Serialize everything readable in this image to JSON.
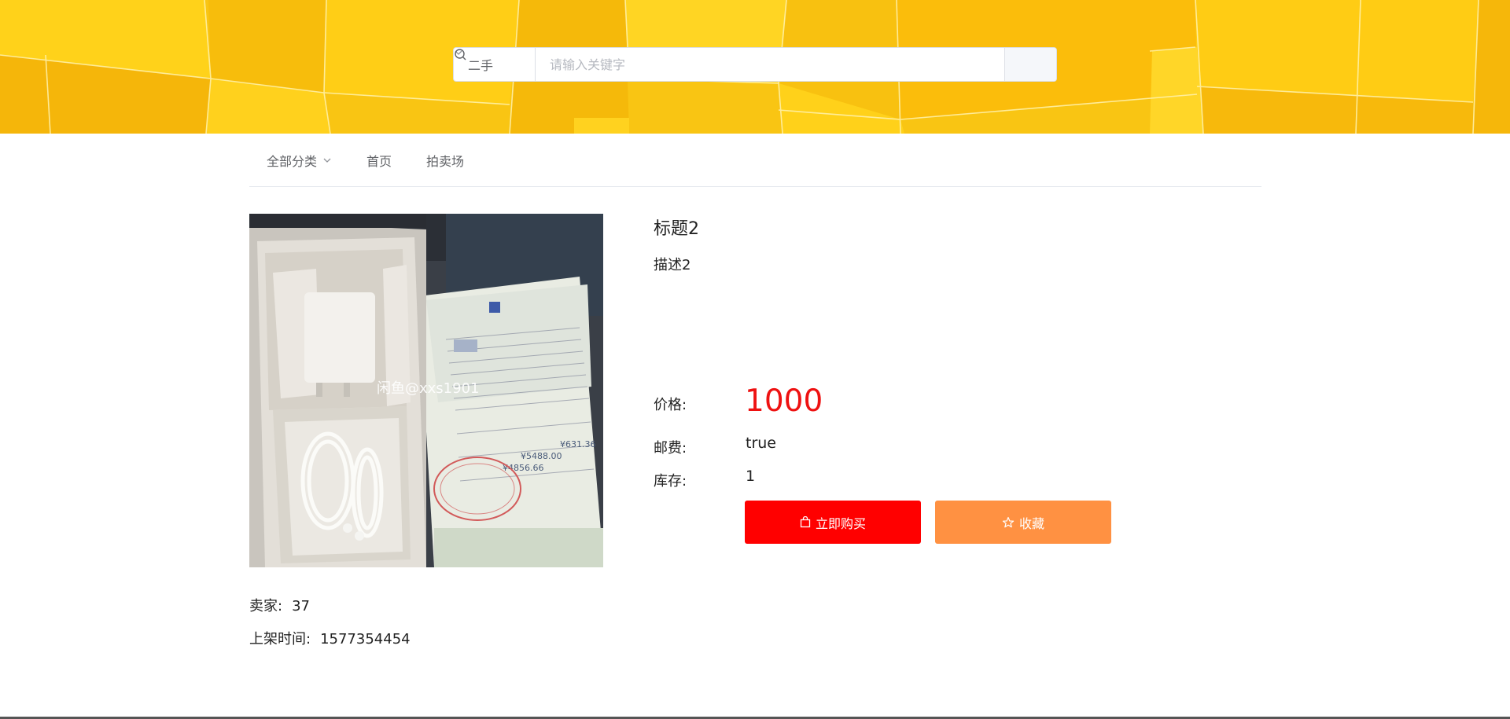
{
  "search": {
    "category_selected": "二手",
    "placeholder": "请输入关键字",
    "value": ""
  },
  "nav": {
    "items": [
      {
        "label": "全部分类",
        "has_dropdown": true
      },
      {
        "label": "首页"
      },
      {
        "label": "拍卖场"
      }
    ]
  },
  "product": {
    "title": "标题2",
    "description": "描述2",
    "image_watermark": "闲鱼@xxs1901",
    "price_label": "价格:",
    "price": "1000",
    "shipping_label": "邮费:",
    "shipping": "true",
    "stock_label": "库存:",
    "stock": "1",
    "buy_label": "立即购买",
    "favorite_label": "收藏"
  },
  "seller": {
    "seller_label": "卖家:",
    "seller_value": "37",
    "listed_label": "上架时间:",
    "listed_value": "1577354454"
  },
  "colors": {
    "banner": "#f9c513",
    "buy_button": "#ff0000",
    "favorite_button": "#ff9142",
    "price": "#ee1111"
  },
  "icons": {
    "select_arrow": "chevron-down-icon",
    "search": "search-icon",
    "buy": "bag-icon",
    "favorite": "star-icon"
  }
}
